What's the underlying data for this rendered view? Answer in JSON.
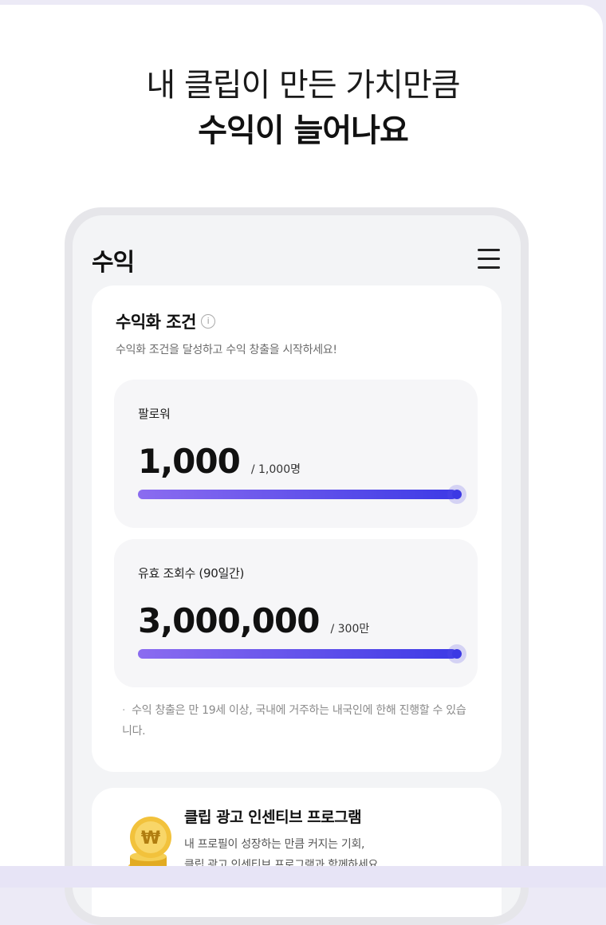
{
  "headline": {
    "line1": "내 클립이 만든 가치만큼",
    "line2": "수익이 늘어나요"
  },
  "app": {
    "title": "수익",
    "menu_icon": "hamburger-menu-icon"
  },
  "monetization": {
    "title": "수익화 조건",
    "info_icon": "info-icon",
    "subtitle": "수익화 조건을 달성하고 수익 창출을 시작하세요!",
    "metrics": [
      {
        "label": "팔로워",
        "value": "1,000",
        "target": "/ 1,000명",
        "progress": 1.0
      },
      {
        "label": "유효 조회수 (90일간)",
        "value": "3,000,000",
        "target": "/ 300만",
        "progress": 1.0
      }
    ],
    "note": "수익 창출은 만 19세 이상, 국내에 거주하는 내국인에 한해 진행할 수 있습니다."
  },
  "ad_program": {
    "icon": "coin-stack-icon",
    "title": "클립 광고 인센티브 프로그램",
    "desc_line1": "내 프로필이 성장하는 만큼 커지는 기회,",
    "desc_line2": "클립 광고 인센티브 프로그램과 함께하세요."
  },
  "colors": {
    "bar_start": "#8b6cf0",
    "bar_end": "#3d3ae6",
    "page_bg": "#eceaf6"
  }
}
